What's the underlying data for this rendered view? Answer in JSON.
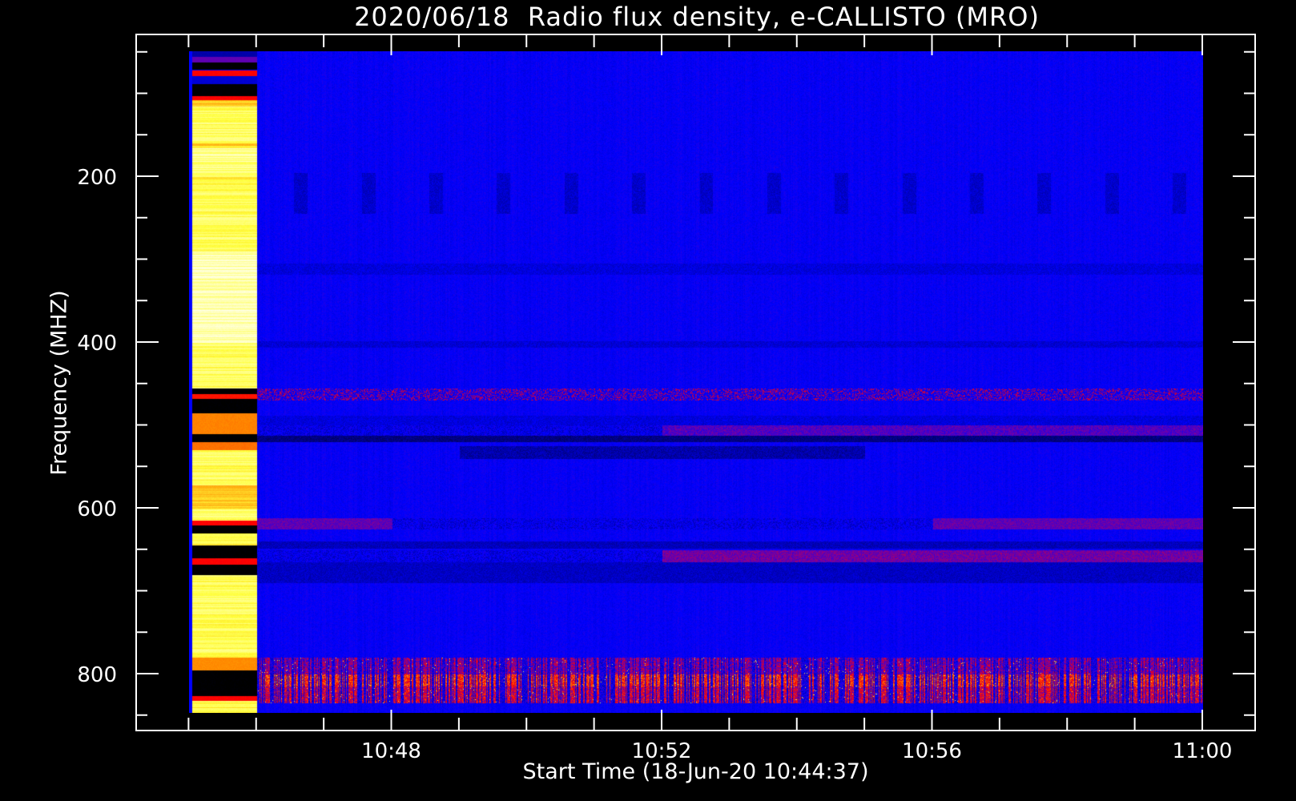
{
  "chart_data": {
    "type": "heatmap",
    "title": "2020/06/18  Radio flux density, e-CALLISTO (MRO)",
    "xlabel": "Start Time (18-Jun-20 10:44:37)",
    "ylabel": "Frequency (MHZ)",
    "x_unit": "minutes after 10:00 UT",
    "xlim": [
      44.23,
      60.77
    ],
    "data_xrange": [
      45.0,
      60.0
    ],
    "ylim": [
      869,
      29
    ],
    "data_yrange": [
      49,
      847
    ],
    "x_major_ticks": [
      {
        "value": 48,
        "label": "10:48"
      },
      {
        "value": 52,
        "label": "10:52"
      },
      {
        "value": 56,
        "label": "10:56"
      },
      {
        "value": 60,
        "label": "11:00"
      }
    ],
    "x_minor_step": 1,
    "y_major_ticks": [
      {
        "value": 200,
        "label": "200"
      },
      {
        "value": 400,
        "label": "400"
      },
      {
        "value": 600,
        "label": "600"
      },
      {
        "value": 800,
        "label": "800"
      }
    ],
    "y_minor_step": 50,
    "colormap": [
      "#000000",
      "#0000ff",
      "#7800a0",
      "#ff0000",
      "#ff8c00",
      "#ffff3c",
      "#ffffe6"
    ],
    "background_level": 0.3,
    "calibration_interval": [
      45.0,
      46.0
    ],
    "calibration_bands": [
      [
        49,
        55,
        0.2
      ],
      [
        55,
        62,
        0.42
      ],
      [
        62,
        71,
        0.0
      ],
      [
        71,
        72,
        0.3
      ],
      [
        72,
        78,
        0.6
      ],
      [
        78,
        88,
        0.25
      ],
      [
        88,
        103,
        0.0
      ],
      [
        103,
        107,
        0.6
      ],
      [
        107,
        115,
        0.82
      ],
      [
        115,
        160,
        0.9
      ],
      [
        160,
        165,
        0.83
      ],
      [
        165,
        200,
        0.93
      ],
      [
        200,
        203,
        0.83
      ],
      [
        203,
        290,
        0.9
      ],
      [
        290,
        400,
        0.96
      ],
      [
        400,
        455,
        0.9
      ],
      [
        455,
        462,
        0.0
      ],
      [
        462,
        468,
        0.62
      ],
      [
        468,
        485,
        0.0
      ],
      [
        485,
        510,
        0.74
      ],
      [
        510,
        520,
        0.0
      ],
      [
        520,
        530,
        0.72
      ],
      [
        530,
        572,
        0.9
      ],
      [
        572,
        600,
        0.82
      ],
      [
        600,
        615,
        0.9
      ],
      [
        615,
        620,
        0.6
      ],
      [
        620,
        630,
        0.0
      ],
      [
        630,
        645,
        0.88
      ],
      [
        645,
        660,
        0.0
      ],
      [
        660,
        668,
        0.6
      ],
      [
        668,
        680,
        0.0
      ],
      [
        680,
        780,
        0.9
      ],
      [
        780,
        795,
        0.75
      ],
      [
        795,
        826,
        0.0
      ],
      [
        826,
        832,
        0.6
      ],
      [
        832,
        847,
        0.88
      ]
    ],
    "main_bands": [
      [
        195,
        245,
        0.24,
        "periodic"
      ],
      [
        305,
        318,
        0.26,
        "flat"
      ],
      [
        398,
        406,
        0.25,
        "flat"
      ],
      [
        455,
        470,
        0.43,
        "speckle"
      ],
      [
        488,
        500,
        0.26,
        "flat"
      ],
      [
        500,
        512,
        0.4,
        "late"
      ],
      [
        512,
        520,
        0.15,
        "flat"
      ],
      [
        525,
        540,
        0.2,
        "mid"
      ],
      [
        612,
        625,
        0.42,
        "early"
      ],
      [
        640,
        648,
        0.22,
        "flat"
      ],
      [
        650,
        665,
        0.44,
        "late"
      ],
      [
        665,
        690,
        0.23,
        "flat"
      ],
      [
        780,
        800,
        0.42,
        "burst"
      ],
      [
        800,
        815,
        0.58,
        "burst"
      ],
      [
        815,
        835,
        0.5,
        "burst"
      ]
    ]
  }
}
